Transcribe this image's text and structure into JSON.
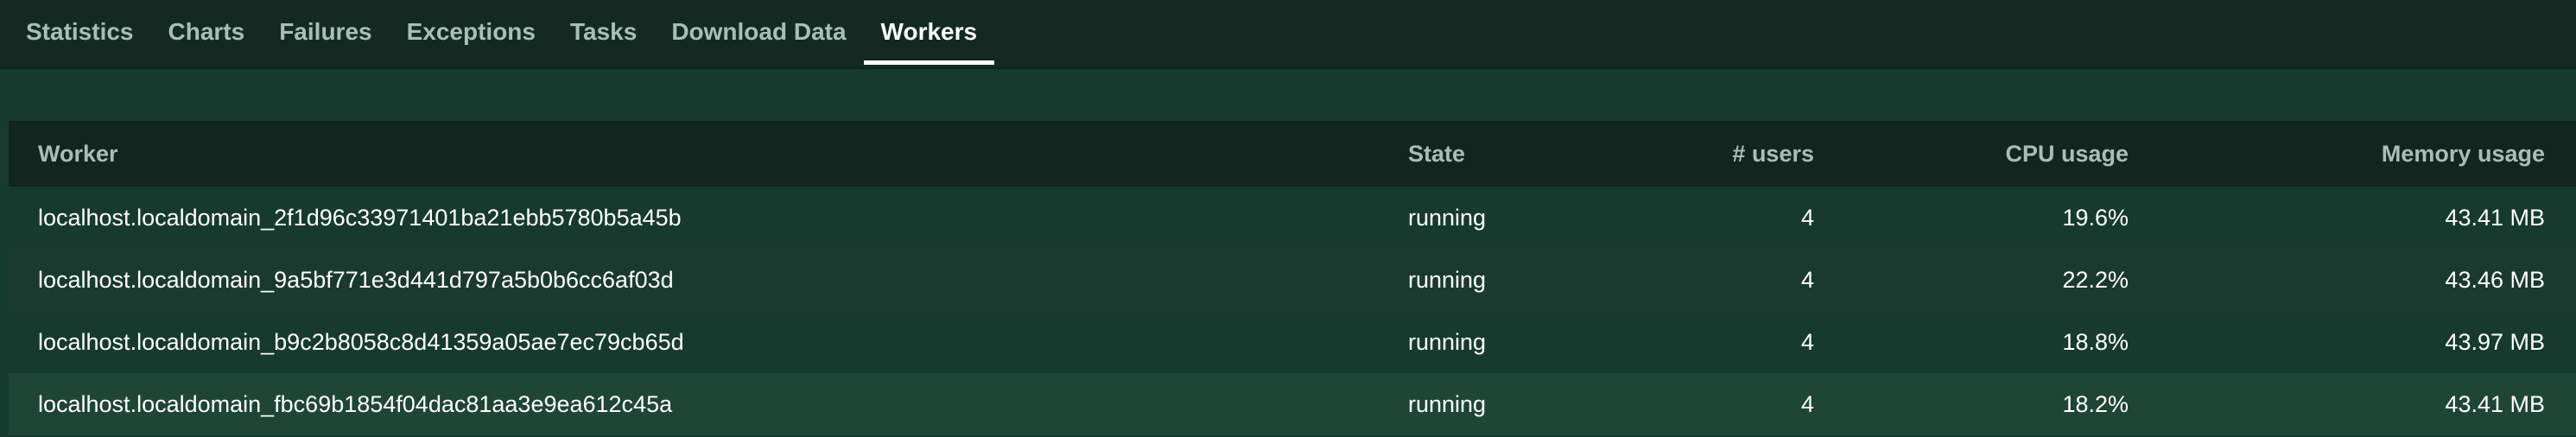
{
  "tabs": [
    {
      "label": "Statistics",
      "active": false
    },
    {
      "label": "Charts",
      "active": false
    },
    {
      "label": "Failures",
      "active": false
    },
    {
      "label": "Exceptions",
      "active": false
    },
    {
      "label": "Tasks",
      "active": false
    },
    {
      "label": "Download Data",
      "active": false
    },
    {
      "label": "Workers",
      "active": true
    }
  ],
  "workers_table": {
    "headers": {
      "worker": "Worker",
      "state": "State",
      "users": "# users",
      "cpu": "CPU usage",
      "memory": "Memory usage"
    },
    "rows": [
      {
        "worker": "localhost.localdomain_2f1d96c33971401ba21ebb5780b5a45b",
        "state": "running",
        "users": "4",
        "cpu": "19.6%",
        "memory": "43.41 MB"
      },
      {
        "worker": "localhost.localdomain_9a5bf771e3d441d797a5b0b6cc6af03d",
        "state": "running",
        "users": "4",
        "cpu": "22.2%",
        "memory": "43.46 MB"
      },
      {
        "worker": "localhost.localdomain_b9c2b8058c8d41359a05ae7ec79cb65d",
        "state": "running",
        "users": "4",
        "cpu": "18.8%",
        "memory": "43.97 MB"
      },
      {
        "worker": "localhost.localdomain_fbc69b1854f04dac81aa3e9ea612c45a",
        "state": "running",
        "users": "4",
        "cpu": "18.2%",
        "memory": "43.41 MB"
      }
    ]
  },
  "colors": {
    "page_background": "#173a2e",
    "tabbar_background": "#132a22",
    "table_header_background": "#12251e",
    "muted_text": "#a6c0b6",
    "active_tab_text": "#ffffff"
  }
}
